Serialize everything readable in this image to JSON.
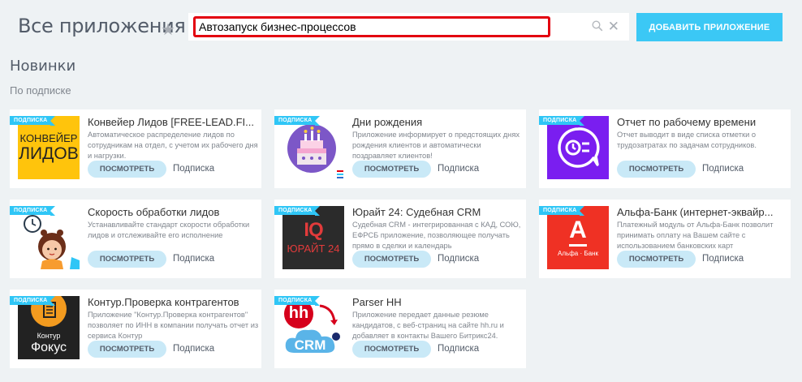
{
  "header": {
    "title": "Все приложения",
    "search_value": "Автозапуск бизнес-процессов",
    "add_button": "ДОБАВИТЬ ПРИЛОЖЕНИЕ"
  },
  "section": {
    "title": "Новинки",
    "subtitle": "По подписке"
  },
  "cards": [
    {
      "badge": "ПОДПИСКА",
      "title": "Конвейер Лидов [FREE-LEAD.FI...",
      "desc": "Автоматическое распределение лидов по сотрудникам на отдел, с учетом их рабочего дня и нагрузки.",
      "button": "ПОСМОТРЕТЬ",
      "price": "Подписка",
      "logo_lines": [
        "КОНВЕЙЕР",
        "ЛИДОВ"
      ]
    },
    {
      "badge": "ПОДПИСКА",
      "title": "Дни рождения",
      "desc": "Приложение информирует о предстоящих днях рождения клиентов и автоматически поздравляет клиентов!",
      "button": "ПОСМОТРЕТЬ",
      "price": "Подписка"
    },
    {
      "badge": "ПОДПИСКА",
      "title": "Отчет по рабочему времени",
      "desc": "Отчет выводит в виде списка отметки о трудозатратах по задачам сотрудников.",
      "button": "ПОСМОТРЕТЬ",
      "price": "Подписка"
    },
    {
      "badge": "ПОДПИСКА",
      "title": "Скорость обработки лидов",
      "desc": "Устанавливайте стандарт скорости обработки лидов и отслеживайте его исполнение",
      "button": "ПОСМОТРЕТЬ",
      "price": "Подписка"
    },
    {
      "badge": "ПОДПИСКА",
      "title": "Юрайт 24: Судебная CRM",
      "desc": "Судебная CRM - интегрированная с КАД, СОЮ, ЕФРСБ приложение, позволяющее получать прямо в сделки и календарь",
      "button": "ПОСМОТРЕТЬ",
      "price": "Подписка",
      "logo_lines": [
        "IQ",
        "ЮРАЙТ 24"
      ]
    },
    {
      "badge": "ПОДПИСКА",
      "title": "Альфа-Банк (интернет-эквайр...",
      "desc": "Платежный модуль от Альфа-Банк позволит принимать оплату на Вашем сайте с использованием банковских карт",
      "button": "ПОСМОТРЕТЬ",
      "price": "Подписка",
      "logo_lines": [
        "А",
        "Альфа · Банк"
      ]
    },
    {
      "badge": "ПОДПИСКА",
      "title": "Контур.Проверка контрагентов",
      "desc": "Приложение \"Контур.Проверка контрагентов\" позволяет по ИНН в компании получать отчет из сервиса Контур",
      "button": "ПОСМОТРЕТЬ",
      "price": "Подписка",
      "logo_lines": [
        "Контур",
        "Фокус"
      ]
    },
    {
      "badge": "ПОДПИСКА",
      "title": "Parser HH",
      "desc": "Приложение передает данные резюме кандидатов, с веб-страниц на сайте hh.ru и добавляет в контакты Вашего Битрикс24.",
      "button": "ПОСМОТРЕТЬ",
      "price": "Подписка",
      "logo_lines": [
        "hh",
        "CRM"
      ]
    }
  ],
  "colors": {
    "accent": "#3bc8f5",
    "badge": "#2fc6f6",
    "button_bg": "#c9e9f7",
    "search_border": "#e3000f"
  }
}
